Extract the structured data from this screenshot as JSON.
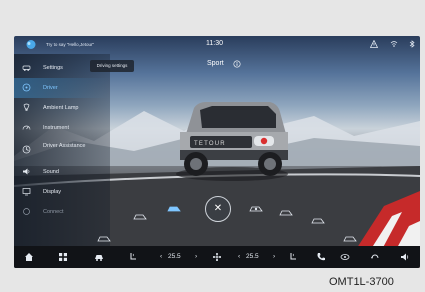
{
  "status_bar": {
    "voice_hint": "Try to say \"Hello,Jetour\"",
    "time": "11:30"
  },
  "sidebar": {
    "items": [
      {
        "label": "Settings",
        "icon": "car-settings-icon"
      },
      {
        "label": "Driver",
        "icon": "steering-wheel-icon"
      },
      {
        "label": "Ambient Lamp",
        "icon": "lamp-icon"
      },
      {
        "label": "Instrument",
        "icon": "gauge-icon"
      },
      {
        "label": "Driver Assistance",
        "icon": "assist-icon"
      },
      {
        "label": "Sound",
        "icon": "speaker-icon"
      },
      {
        "label": "Display",
        "icon": "display-icon"
      },
      {
        "label": "Connect",
        "icon": "connect-icon"
      }
    ],
    "active_index": 1
  },
  "popup": {
    "label": "Driving settings"
  },
  "drive_mode": {
    "label": "Sport"
  },
  "dock": {
    "left_temp": "25.5",
    "right_temp": "25.5"
  },
  "caption": "OMT1L-3700",
  "colors": {
    "accent": "#7fc6ff",
    "dock": "#111317"
  }
}
